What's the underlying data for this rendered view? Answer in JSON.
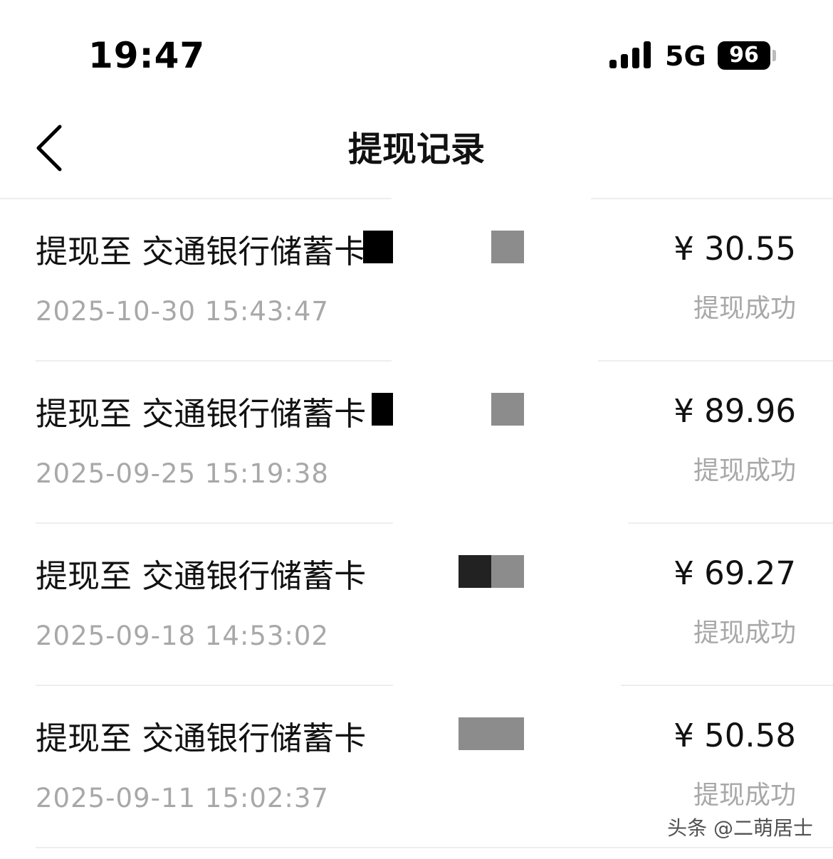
{
  "status_bar": {
    "time": "19:47",
    "network": "5G",
    "battery": "96",
    "signal_icon": "cellular-signal-icon"
  },
  "nav": {
    "back_icon": "chevron-left-icon",
    "title": "提现记录"
  },
  "records": [
    {
      "title": "提现至 交通银行储蓄卡",
      "date": "2025-10-30 15:43:47",
      "amount": "¥ 30.55",
      "status": "提现成功"
    },
    {
      "title": "提现至 交通银行储蓄卡",
      "date": "2025-09-25 15:19:38",
      "amount": "¥ 89.96",
      "status": "提现成功"
    },
    {
      "title": "提现至 交通银行储蓄卡",
      "date": "2025-09-18 14:53:02",
      "amount": "¥ 69.27",
      "status": "提现成功"
    },
    {
      "title": "提现至 交通银行储蓄卡",
      "date": "2025-09-11 15:02:37",
      "amount": "¥ 50.58",
      "status": "提现成功"
    }
  ],
  "watermark": "头条 @二萌居士",
  "colors": {
    "text_primary": "#111111",
    "text_secondary": "#a8a8a8",
    "divider": "#eeeeee"
  }
}
